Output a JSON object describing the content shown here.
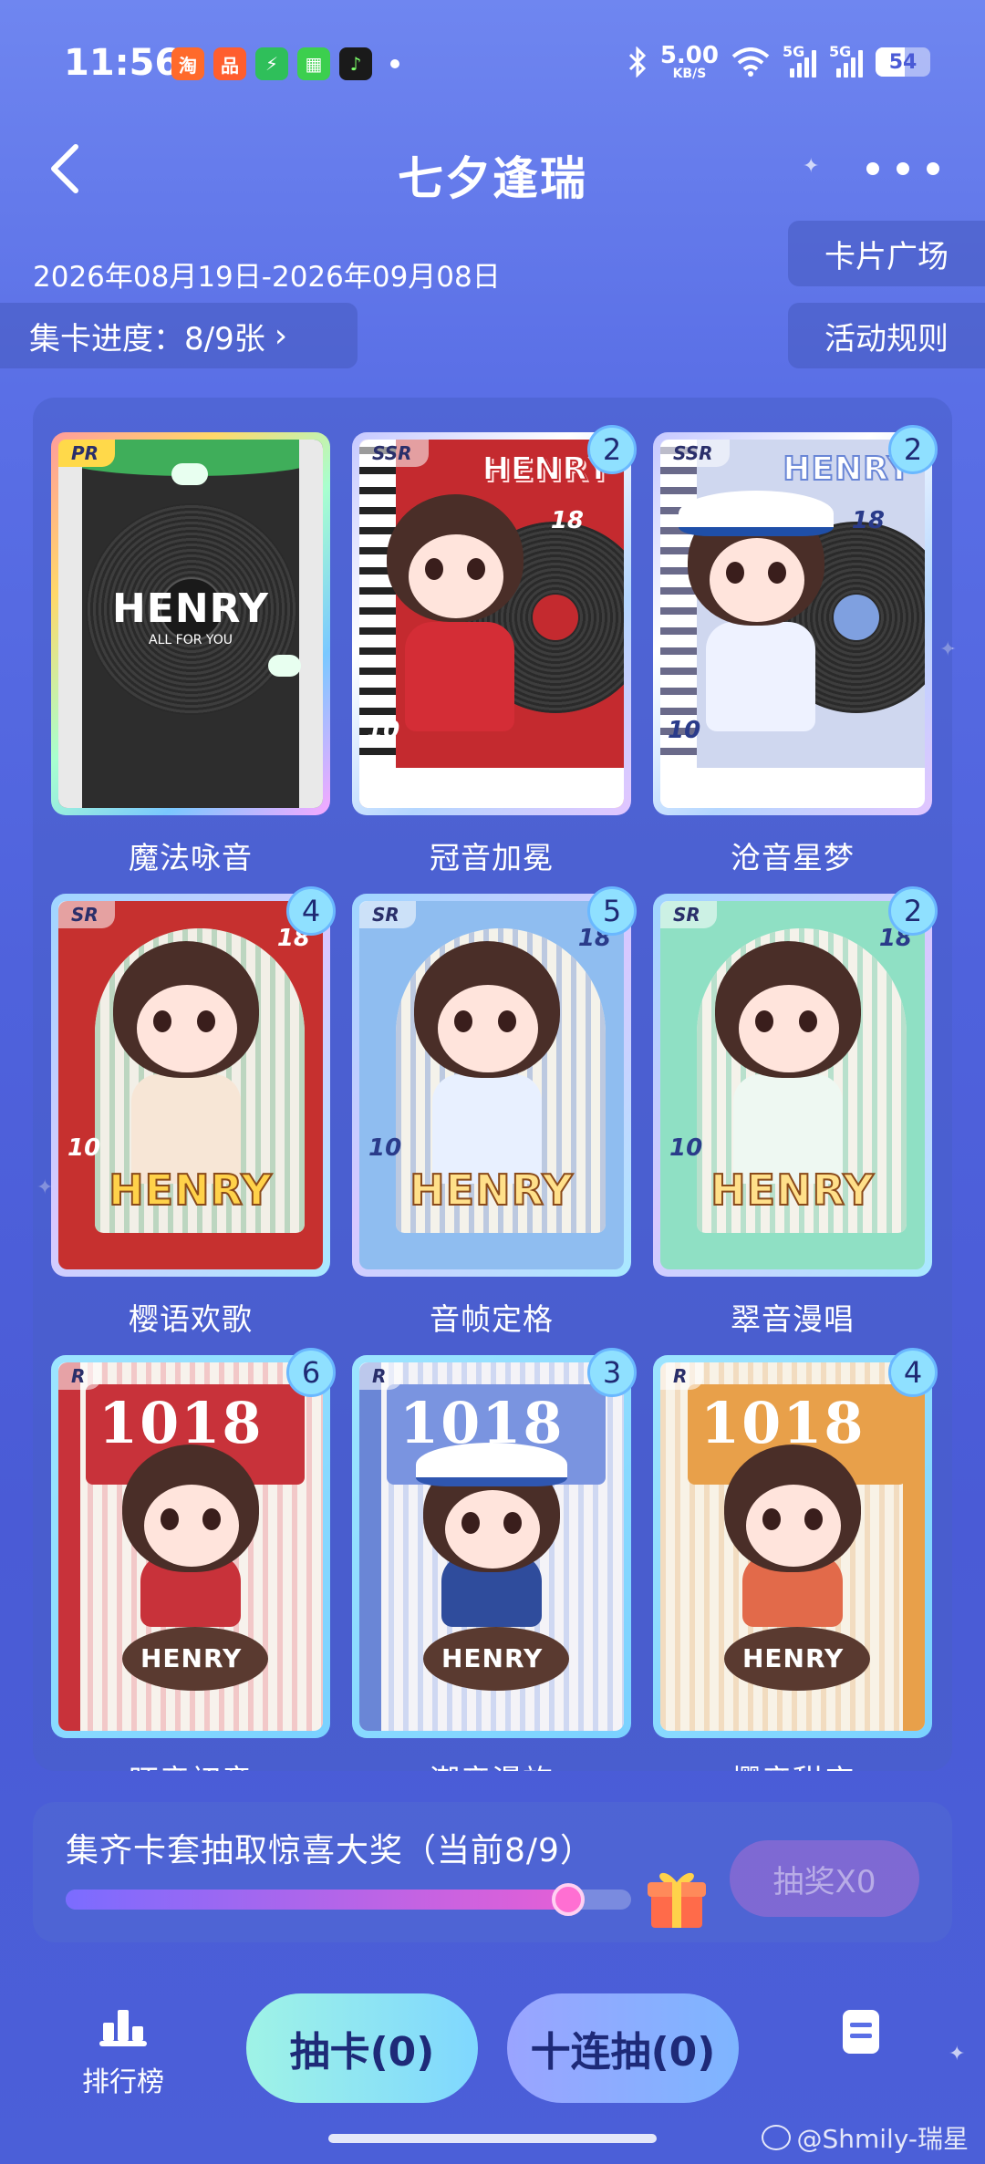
{
  "status_bar": {
    "time": "11:56",
    "app_icons": [
      {
        "name": "taobao-icon",
        "glyph": "淘",
        "color": "#ff6a2b"
      },
      {
        "name": "app-grid-icon",
        "glyph": "品",
        "color": "#ff5e2e"
      },
      {
        "name": "shield-app-icon",
        "glyph": "⚡",
        "color": "#2fbf5a"
      },
      {
        "name": "grid-app-icon",
        "glyph": "▦",
        "color": "#3ccf4e"
      },
      {
        "name": "music-app-icon",
        "glyph": "♪",
        "color": "#1a1a1a"
      }
    ],
    "speed_value": "5.00",
    "speed_unit": "KB/S",
    "network_1": "5G",
    "network_2": "5G",
    "battery": "54"
  },
  "header": {
    "title": "七夕逢瑞",
    "date_range": "2026年08月19日-2026年09月08日",
    "progress_label": "集卡进度：8/9张",
    "card_square_button": "卡片广场",
    "rules_button": "活动规则"
  },
  "cards": [
    {
      "name": "魔法咏音",
      "rarity": "PR",
      "count": ""
    },
    {
      "name": "冠音加冕",
      "rarity": "SSR",
      "count": "2"
    },
    {
      "name": "沧音星梦",
      "rarity": "SSR",
      "count": "2"
    },
    {
      "name": "樱语欢歌",
      "rarity": "SR",
      "count": "4"
    },
    {
      "name": "音帧定格",
      "rarity": "SR",
      "count": "5"
    },
    {
      "name": "翠音漫唱",
      "rarity": "SR",
      "count": "2"
    },
    {
      "name": "旺音初章",
      "rarity": "R",
      "count": "6"
    },
    {
      "name": "潮音漫旅",
      "rarity": "R",
      "count": "3"
    },
    {
      "name": "樱音甜序",
      "rarity": "R",
      "count": "4"
    }
  ],
  "card_art": {
    "henry": "HENRY",
    "all_for_you": "ALL FOR YOU",
    "number_1018": "1018",
    "number_18": "18",
    "number_10": "10"
  },
  "prize": {
    "text": "集齐卡套抽取惊喜大奖（当前8/9）",
    "progress": 0.889,
    "button_label": "抽奖X0"
  },
  "bottom_nav": {
    "rank_label": "排行榜",
    "draw_one": "抽卡(0)",
    "draw_ten": "十连抽(0)"
  },
  "watermark": "@Shmily-瑞星"
}
